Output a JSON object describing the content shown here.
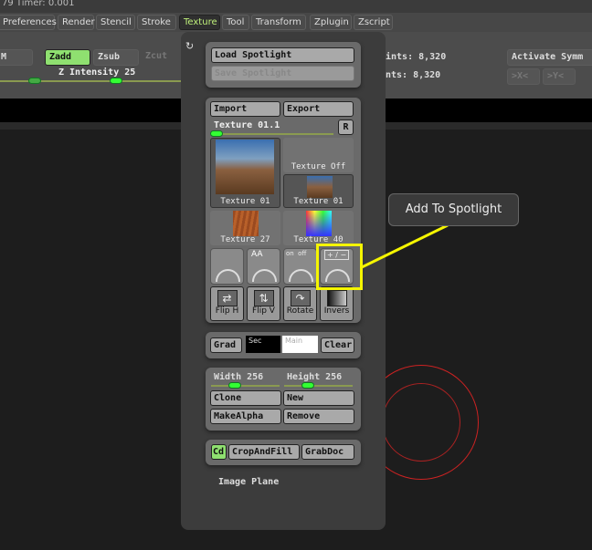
{
  "titlebar": {
    "text": "79 Timer: 0.001"
  },
  "menu": [
    "Preferences",
    "Render",
    "Stencil",
    "Stroke",
    "Texture",
    "Tool",
    "Transform",
    "Zplugin",
    "Zscript"
  ],
  "toolbar": {
    "m": "M",
    "zadd": "Zadd",
    "zsub": "Zsub",
    "zcut": "Zcut",
    "z_intensity": "Z Intensity 25",
    "points1": "ints: 8,320",
    "points2": "nts: 8,320",
    "activate_symm": "Activate Symm",
    "sym_x": ">X<",
    "sym_y": ">Y<"
  },
  "panel": {
    "load_spotlight": "Load Spotlight",
    "save_spotlight": "Save Spotlight",
    "import": "Import",
    "export": "Export",
    "texture_name": "Texture 01.1",
    "r": "R",
    "thumbs": [
      "Texture 01",
      "Texture Off",
      "Texture 01",
      "Texture 27",
      "Texture 40"
    ],
    "dial_aa": "AA",
    "dial_onoff": "on  off",
    "dial_plusminus": "+ / −",
    "flip_h": "Flip H",
    "flip_v": "Flip V",
    "rotate": "Rotate",
    "invers": "Invers",
    "grad": "Grad",
    "sec": "Sec",
    "main": "Main",
    "clear": "Clear",
    "width": "Width 256",
    "height": "Height 256",
    "width_value": 256,
    "height_value": 256,
    "clone": "Clone",
    "new": "New",
    "make_alpha": "MakeAlpha",
    "remove": "Remove",
    "cd": "Cd",
    "crop_and_fill": "CropAndFill",
    "grab_doc": "GrabDoc",
    "image_plane": "Image Plane"
  },
  "tooltip": "Add To Spotlight",
  "colors": {
    "accent": "#bff07a",
    "highlight": "#f5f500"
  }
}
